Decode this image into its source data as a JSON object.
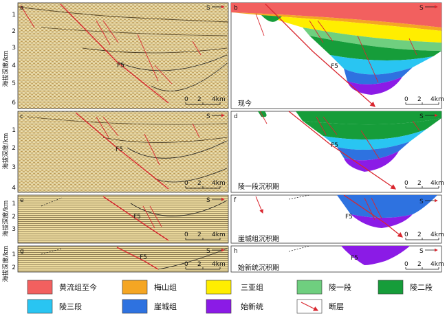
{
  "axis": {
    "ylabel": "海拔深度/km",
    "panel_a_ticks": [
      "1",
      "2",
      "3",
      "4",
      "5",
      "6"
    ],
    "panel_c_ticks": [
      "1",
      "2",
      "3",
      "4"
    ],
    "panel_e_ticks": [
      "1",
      "2",
      "3"
    ],
    "panel_g_ticks": [
      "1",
      "2"
    ]
  },
  "panels": {
    "a": {
      "letter": "a"
    },
    "b": {
      "letter": "b",
      "caption": "现今"
    },
    "c": {
      "letter": "c"
    },
    "d": {
      "letter": "d",
      "caption": "陵一段沉积期"
    },
    "e": {
      "letter": "e"
    },
    "f": {
      "letter": "f",
      "caption": "崖城组沉积期"
    },
    "g": {
      "letter": "g"
    },
    "h": {
      "letter": "h",
      "caption": "始新统沉积期"
    }
  },
  "common": {
    "fault_label": "F5",
    "south": "S",
    "scale": {
      "zero": "0",
      "two": "2",
      "four": "4km"
    }
  },
  "legend": [
    {
      "label": "黄流组至今",
      "color": "#f2605f"
    },
    {
      "label": "梅山组",
      "color": "#f5a623"
    },
    {
      "label": "三亚组",
      "color": "#ffee00"
    },
    {
      "label": "陵一段",
      "color": "#6fcf7f"
    },
    {
      "label": "陵二段",
      "color": "#169d3a"
    },
    {
      "label": "陵三段",
      "color": "#29c5f2"
    },
    {
      "label": "崖城组",
      "color": "#2e72e0"
    },
    {
      "label": "始新统",
      "color": "#8b1be6"
    },
    {
      "label": "断层",
      "icon": "fault-arrow-icon",
      "color": "#d9262e"
    }
  ]
}
